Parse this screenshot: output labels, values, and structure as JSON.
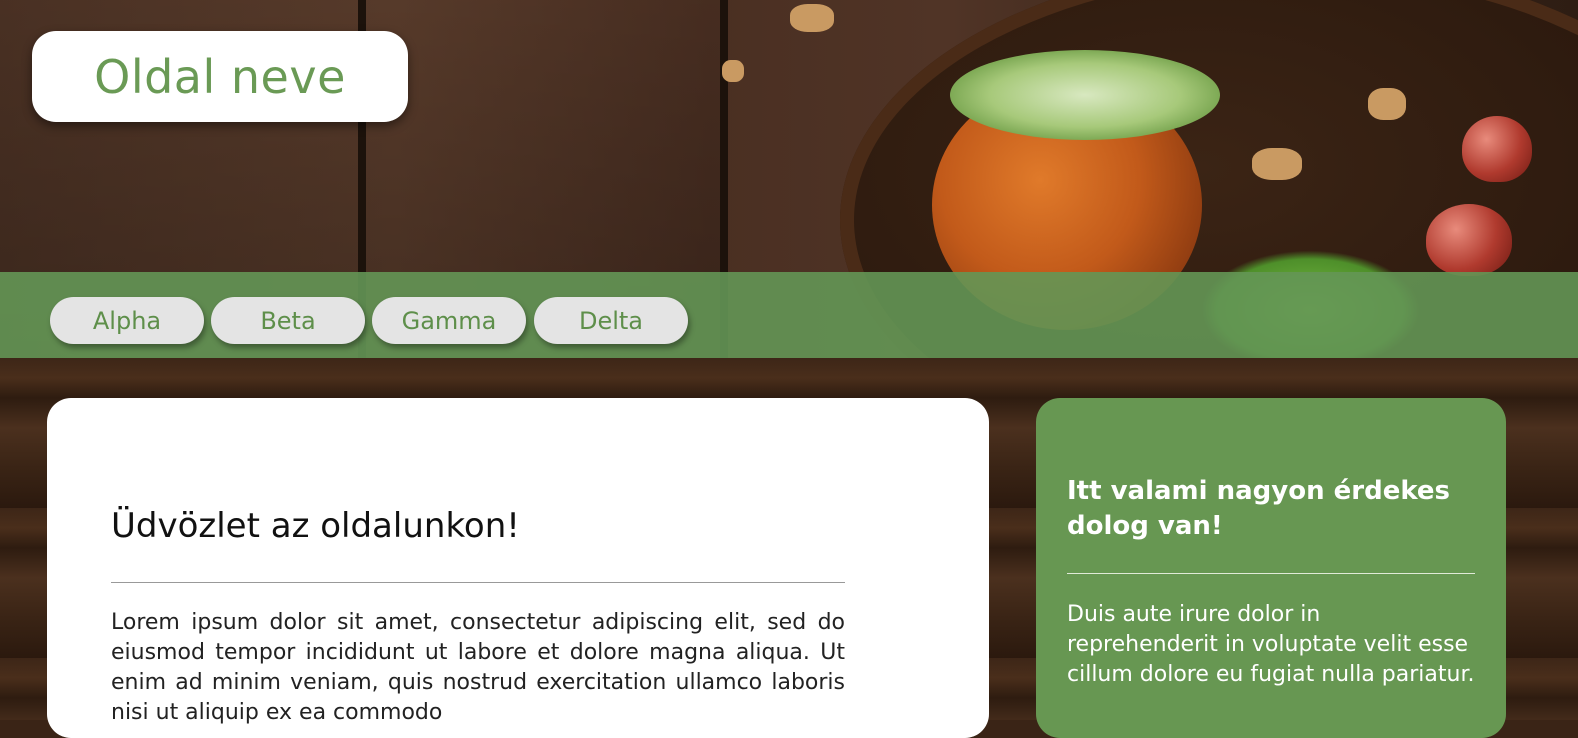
{
  "site": {
    "title": "Oldal neve"
  },
  "nav": {
    "items": [
      {
        "label": "Alpha"
      },
      {
        "label": "Beta"
      },
      {
        "label": "Gamma"
      },
      {
        "label": "Delta"
      }
    ]
  },
  "main": {
    "heading": "Üdvözlet az oldalunkon!",
    "body": "Lorem ipsum dolor sit amet, consectetur adipiscing elit, sed do eiusmod tempor incididunt ut labore et dolore magna aliqua. Ut enim ad minim veniam, quis nostrud exercitation ullamco laboris nisi ut aliquip ex ea commodo"
  },
  "sidebar": {
    "heading": "Itt valami nagyon érdekes dolog van!",
    "body": "Duis aute irure dolor in reprehenderit in voluptate velit esse cillum dolore eu fugiat nulla pariatur."
  },
  "colors": {
    "accent": "#679752",
    "nav_text": "#5e8f4a",
    "logo_text": "#6a9a55"
  }
}
